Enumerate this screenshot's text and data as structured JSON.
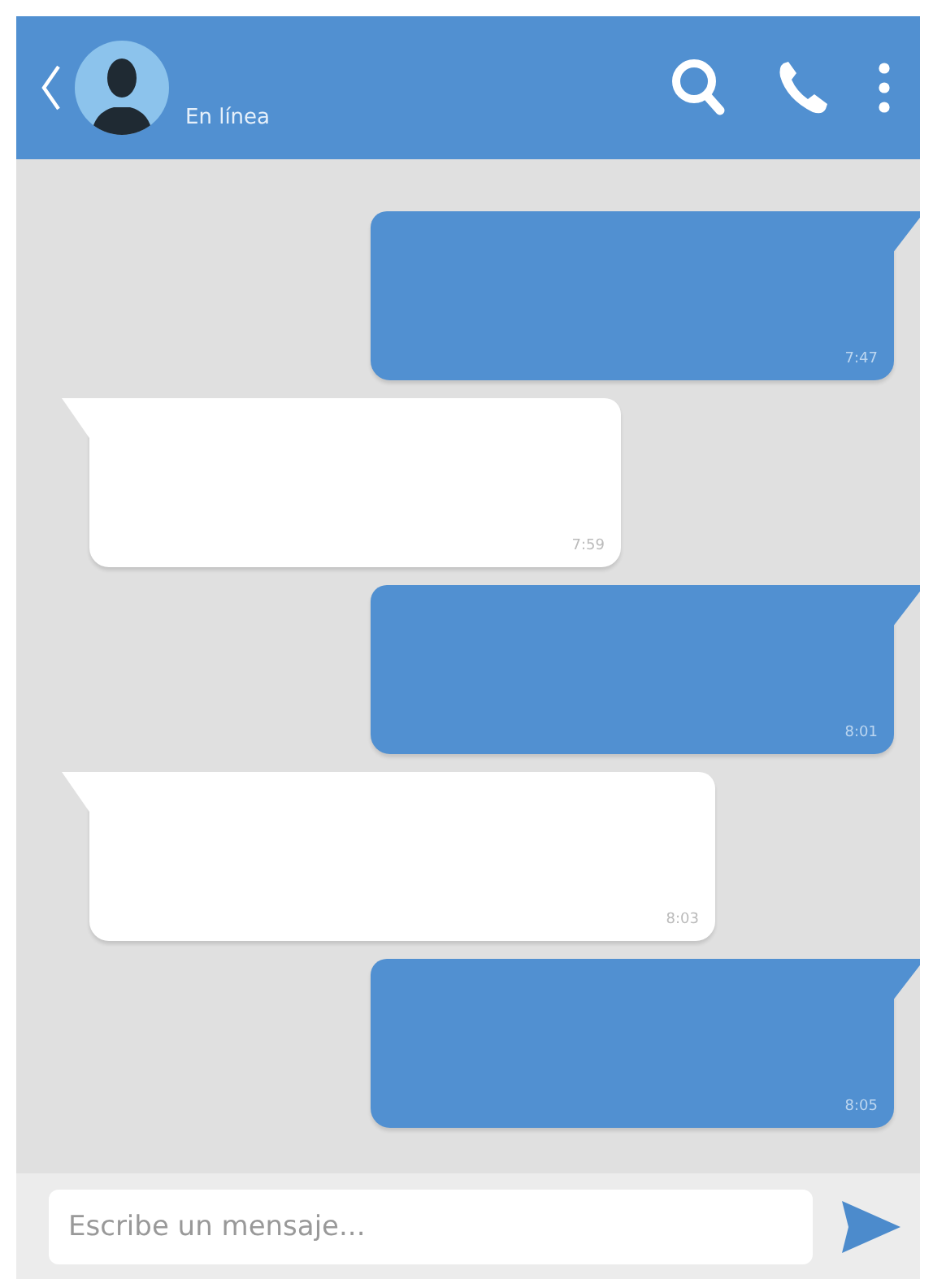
{
  "header": {
    "status": "En línea"
  },
  "messages": [
    {
      "kind": "sent",
      "time": "7:47"
    },
    {
      "kind": "received",
      "time": "7:59"
    },
    {
      "kind": "sent",
      "time": "8:01"
    },
    {
      "kind": "received",
      "time": "8:03"
    },
    {
      "kind": "sent",
      "time": "8:05"
    }
  ],
  "composer": {
    "placeholder": "Escribe un mensaje..."
  }
}
